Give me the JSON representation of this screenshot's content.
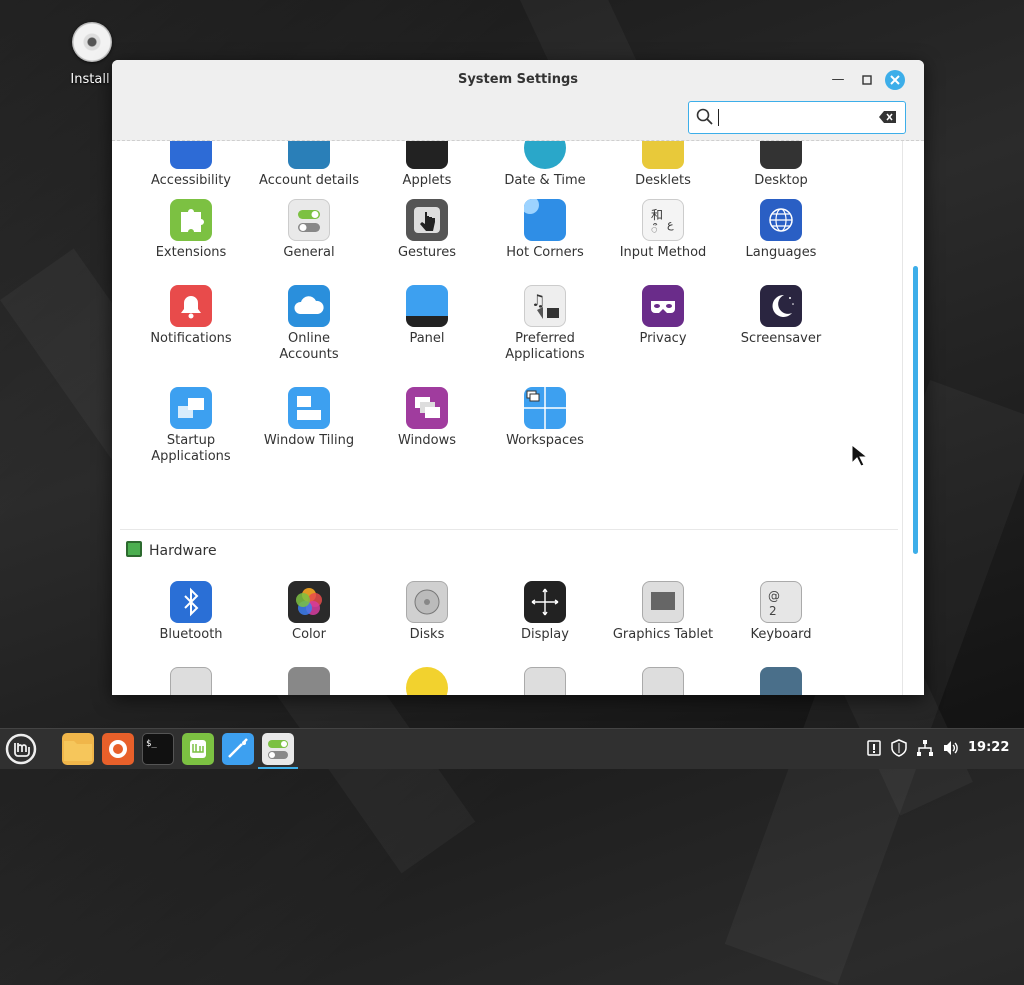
{
  "desktop": {
    "install_label": "Install"
  },
  "window": {
    "title": "System Settings",
    "search_value": "",
    "accent": "#3daee9"
  },
  "appearance_row_partial": [
    {
      "label": "Accessibility",
      "icon": "accessibility-icon"
    },
    {
      "label": "Account details",
      "icon": "account-icon"
    },
    {
      "label": "Applets",
      "icon": "applets-icon"
    },
    {
      "label": "Date & Time",
      "icon": "clock-icon"
    },
    {
      "label": "Desklets",
      "icon": "desklets-icon"
    },
    {
      "label": "Desktop",
      "icon": "desktop-icon"
    }
  ],
  "preferences": [
    {
      "label": "Extensions",
      "icon": "puzzle-icon"
    },
    {
      "label": "General",
      "icon": "toggles-icon"
    },
    {
      "label": "Gestures",
      "icon": "hand-icon"
    },
    {
      "label": "Hot Corners",
      "icon": "hot-corners-icon"
    },
    {
      "label": "Input Method",
      "icon": "input-method-icon"
    },
    {
      "label": "Languages",
      "icon": "globe-icon"
    },
    {
      "label": "Notifications",
      "icon": "bell-icon"
    },
    {
      "label": "Online\nAccounts",
      "icon": "cloud-icon"
    },
    {
      "label": "Panel",
      "icon": "panel-icon"
    },
    {
      "label": "Preferred\nApplications",
      "icon": "preferred-apps-icon"
    },
    {
      "label": "Privacy",
      "icon": "mask-icon"
    },
    {
      "label": "Screensaver",
      "icon": "moon-icon"
    },
    {
      "label": "Startup\nApplications",
      "icon": "startup-icon"
    },
    {
      "label": "Window Tiling",
      "icon": "tiling-icon"
    },
    {
      "label": "Windows",
      "icon": "windows-icon"
    },
    {
      "label": "Workspaces",
      "icon": "workspaces-icon"
    }
  ],
  "hardware": {
    "title": "Hardware",
    "items": [
      {
        "label": "Bluetooth",
        "icon": "bluetooth-icon"
      },
      {
        "label": "Color",
        "icon": "color-icon"
      },
      {
        "label": "Disks",
        "icon": "disk-icon"
      },
      {
        "label": "Display",
        "icon": "display-icon"
      },
      {
        "label": "Graphics Tablet",
        "icon": "tablet-icon"
      },
      {
        "label": "Keyboard",
        "icon": "keyboard-icon"
      }
    ]
  },
  "taskbar": {
    "clock": "19:22"
  }
}
